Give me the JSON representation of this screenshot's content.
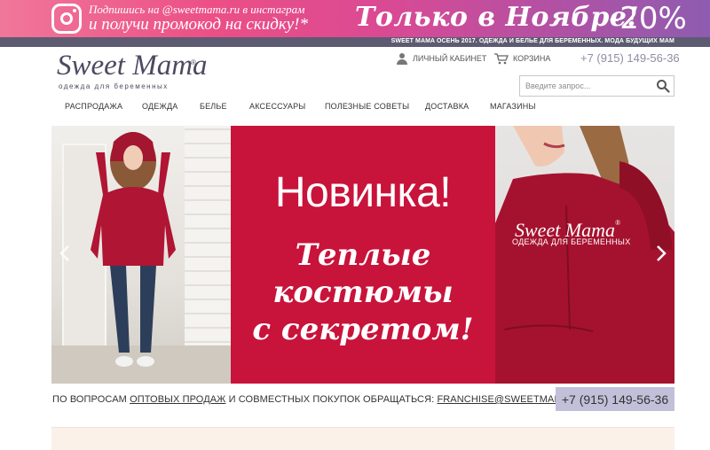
{
  "promo": {
    "line1": "Подпишись на @sweetmama.ru в инстаграм",
    "line2": "и получи промокод на скидку!*",
    "center": "Только в Ноябре!",
    "discount": "-20%",
    "icon": "instagram-icon"
  },
  "subbar": {
    "text": "SWEET MAMA ОСЕНЬ 2017. ОДЕЖДА И БЕЛЬЕ ДЛЯ БЕРЕМЕННЫХ. МОДА БУДУЩИХ МАМ"
  },
  "header": {
    "logo": "Sweet Mama",
    "logo_reg": "®",
    "logo_sub": "одежда для беременных",
    "cabinet": "ЛИЧНЫЙ КАБИНЕТ",
    "cart": "КОРЗИНА",
    "phone": "+7 (915) 149-56-36",
    "search_placeholder": "Введите запрос..."
  },
  "nav": {
    "items": [
      "РАСПРОДАЖА",
      "ОДЕЖДА",
      "БЕЛЬЕ",
      "АКСЕССУАРЫ",
      "ПОЛЕЗНЫЕ СОВЕТЫ",
      "ДОСТАВКА",
      "МАГАЗИНЫ"
    ]
  },
  "hero": {
    "title": "Новинка!",
    "line1": "Теплые",
    "line2": "костюмы",
    "line3": "с секретом!",
    "brand": "Sweet Mama",
    "brand_reg": "®",
    "brand_sub": "ОДЕЖДА ДЛЯ БЕРЕМЕННЫХ",
    "accent": "#c8133b"
  },
  "info": {
    "prefix": "ПО ВОПРОСАМ ",
    "link1": "ОПТОВЫХ ПРОДАЖ",
    "middle": " И СОВМЕСТНЫХ ПОКУПОК ОБРАЩАТЬСЯ: ",
    "email": "FRANCHISE@SWEETMAMA.RU",
    "phone": "+7 (915) 149-56-36"
  }
}
